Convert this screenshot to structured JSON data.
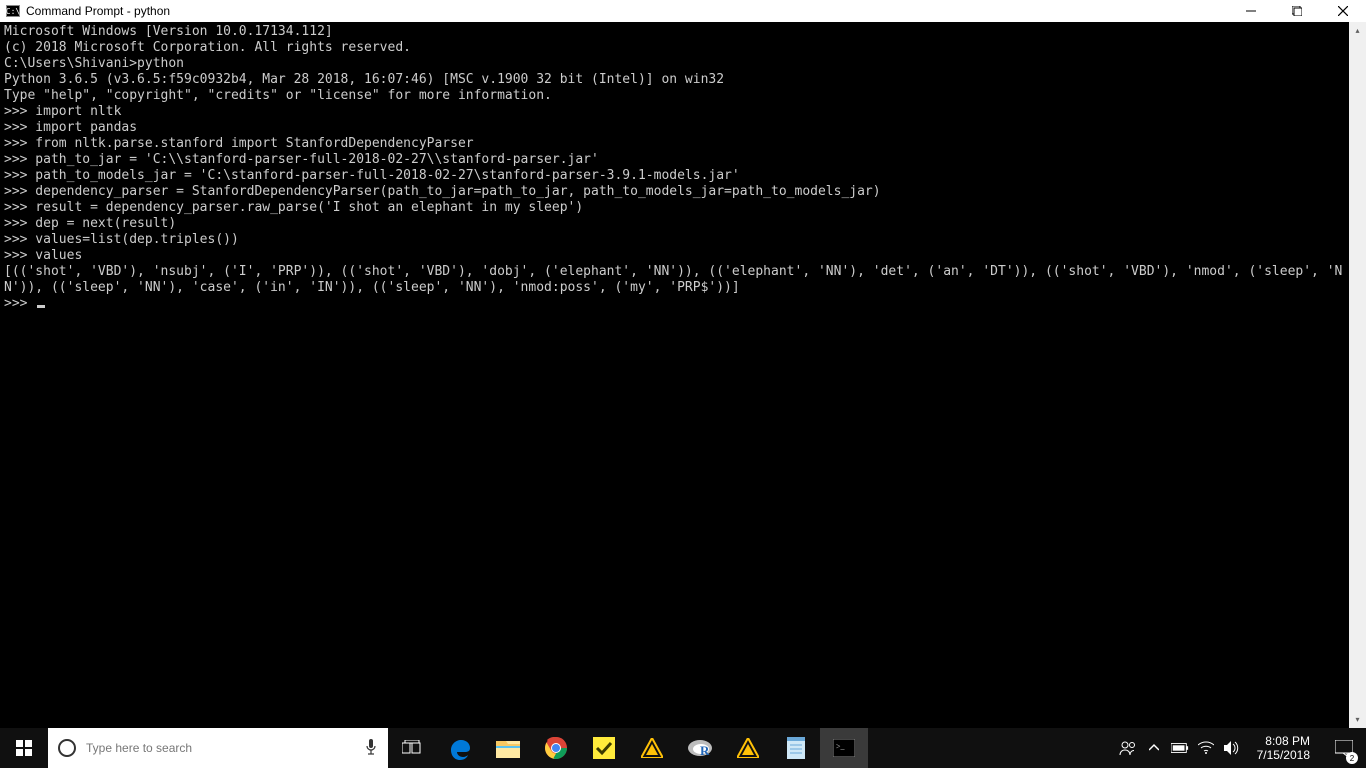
{
  "titlebar": {
    "title": "Command Prompt - python",
    "icon_label": "C:\\"
  },
  "terminal": {
    "lines": [
      "Microsoft Windows [Version 10.0.17134.112]",
      "(c) 2018 Microsoft Corporation. All rights reserved.",
      "",
      "C:\\Users\\Shivani>python",
      "Python 3.6.5 (v3.6.5:f59c0932b4, Mar 28 2018, 16:07:46) [MSC v.1900 32 bit (Intel)] on win32",
      "Type \"help\", \"copyright\", \"credits\" or \"license\" for more information.",
      ">>> import nltk",
      ">>> import pandas",
      ">>> from nltk.parse.stanford import StanfordDependencyParser",
      ">>> path_to_jar = 'C:\\\\stanford-parser-full-2018-02-27\\\\stanford-parser.jar'",
      ">>> path_to_models_jar = 'C:\\stanford-parser-full-2018-02-27\\stanford-parser-3.9.1-models.jar'",
      ">>> dependency_parser = StanfordDependencyParser(path_to_jar=path_to_jar, path_to_models_jar=path_to_models_jar)",
      ">>> result = dependency_parser.raw_parse('I shot an elephant in my sleep')",
      ">>> dep = next(result)",
      ">>> values=list(dep.triples())",
      ">>> values",
      "[(('shot', 'VBD'), 'nsubj', ('I', 'PRP')), (('shot', 'VBD'), 'dobj', ('elephant', 'NN')), (('elephant', 'NN'), 'det', ('an', 'DT')), (('shot', 'VBD'), 'nmod', ('sleep', 'NN')), (('sleep', 'NN'), 'case', ('in', 'IN')), (('sleep', 'NN'), 'nmod:poss', ('my', 'PRP$'))]",
      ">>> "
    ]
  },
  "search": {
    "placeholder": "Type here to search"
  },
  "clock": {
    "time": "8:08 PM",
    "date": "7/15/2018"
  },
  "notif": {
    "count": "2"
  }
}
